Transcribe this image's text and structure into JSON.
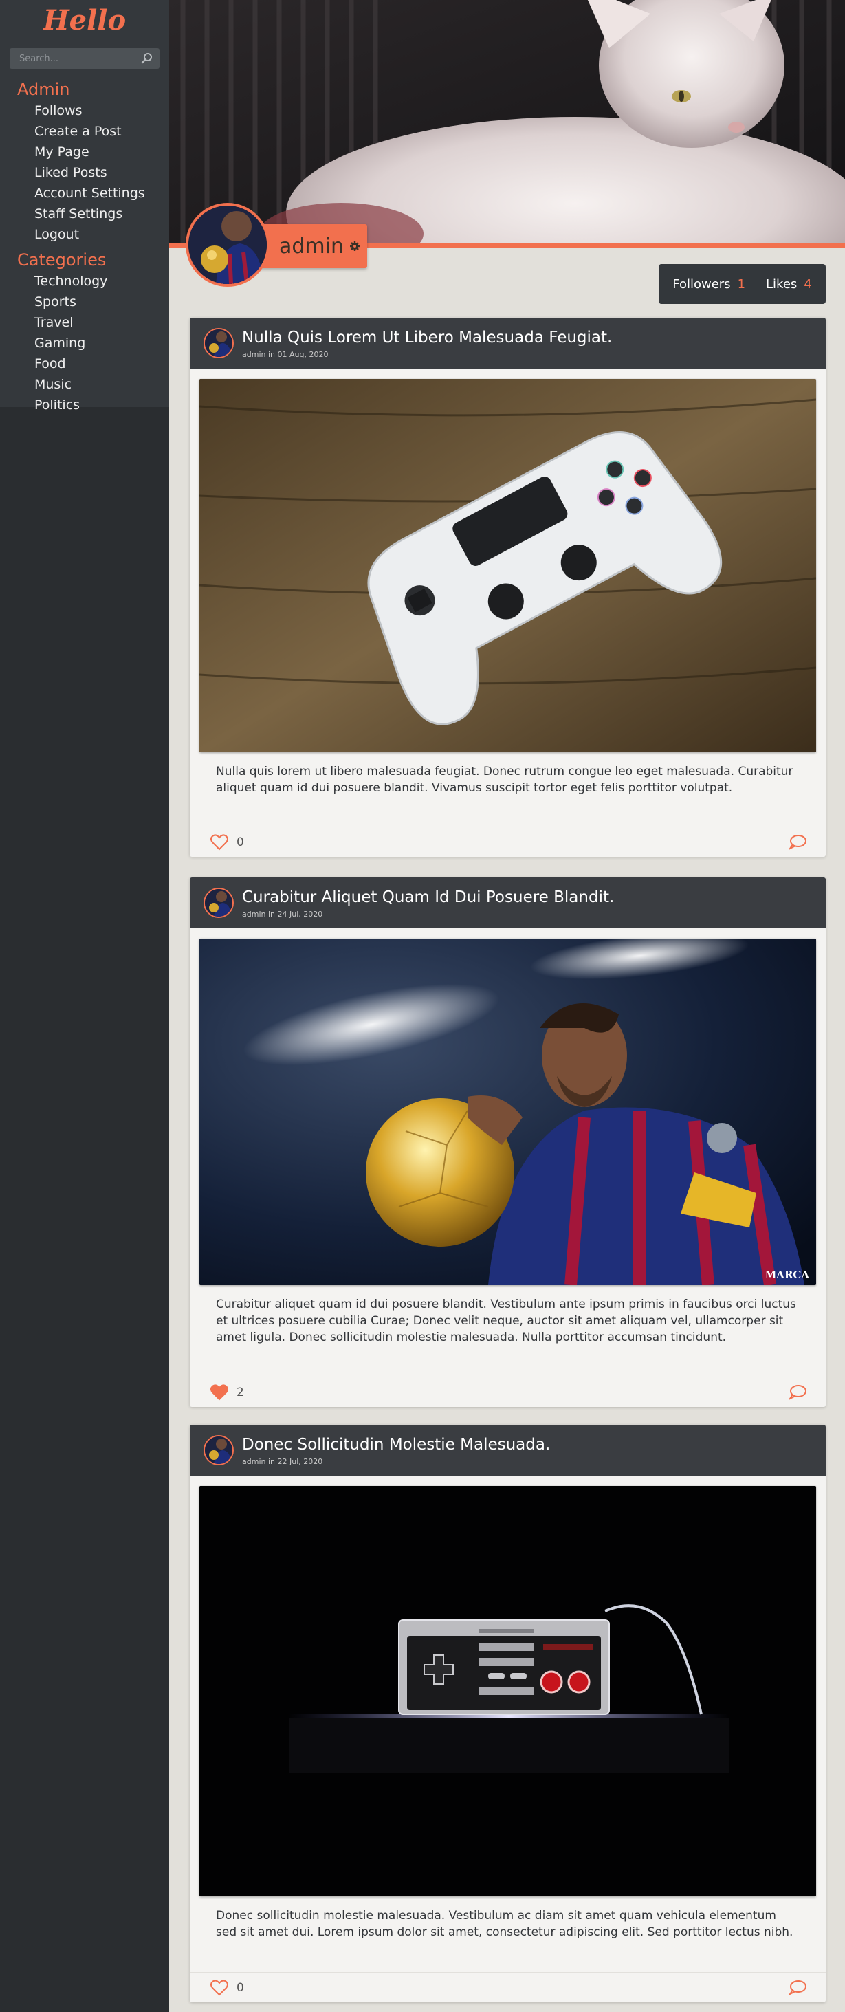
{
  "sidebar": {
    "logo": "Hello",
    "search_placeholder": "Search...",
    "admin_heading": "Admin",
    "admin_items": [
      {
        "label": "Follows"
      },
      {
        "label": "Create a Post"
      },
      {
        "label": "My Page"
      },
      {
        "label": "Liked Posts"
      },
      {
        "label": "Account Settings"
      },
      {
        "label": "Staff Settings"
      },
      {
        "label": "Logout"
      }
    ],
    "categories_heading": "Categories",
    "category_items": [
      {
        "label": "Technology"
      },
      {
        "label": "Sports"
      },
      {
        "label": "Travel"
      },
      {
        "label": "Gaming"
      },
      {
        "label": "Food"
      },
      {
        "label": "Music"
      },
      {
        "label": "Politics"
      }
    ]
  },
  "profile": {
    "username": "admin",
    "followers_label": "Followers",
    "followers_count": "1",
    "likes_label": "Likes",
    "likes_count": "4"
  },
  "posts": [
    {
      "title": "Nulla Quis Lorem Ut Libero Malesuada Feugiat.",
      "meta": "admin in 01 Aug, 2020",
      "image": "white-gamepad-on-wood",
      "body": "Nulla quis lorem ut libero malesuada feugiat. Donec rutrum congue leo eget malesuada. Curabitur aliquet quam id dui posuere blandit. Vivamus suscipit tortor eget felis porttitor volutpat.",
      "likes": "0",
      "liked": false
    },
    {
      "title": "Curabitur Aliquet Quam Id Dui Posuere Blandit.",
      "meta": "admin in 24 Jul, 2020",
      "image": "football-player-with-golden-ball",
      "body": "Curabitur aliquet quam id dui posuere blandit. Vestibulum ante ipsum primis in faucibus orci luctus et ultrices posuere cubilia Curae; Donec velit neque, auctor sit amet aliquam vel, ullamcorper sit amet ligula. Donec sollicitudin molestie malesuada. Nulla porttitor accumsan tincidunt.",
      "likes": "2",
      "liked": true,
      "image_watermark": "MARCA"
    },
    {
      "title": "Donec Sollicitudin Molestie Malesuada.",
      "meta": "admin in 22 Jul, 2020",
      "image": "retro-controller-on-dark",
      "body": "Donec sollicitudin molestie malesuada. Vestibulum ac diam sit amet quam vehicula elementum sed sit amet dui. Lorem ipsum dolor sit amet, consectetur adipiscing elit. Sed porttitor lectus nibh.",
      "likes": "0",
      "liked": false
    }
  ],
  "colors": {
    "accent": "#f2704e",
    "sidebar_bg": "#2a2d30",
    "header_bg": "#3a3d41",
    "page_bg": "#e2e0da"
  }
}
